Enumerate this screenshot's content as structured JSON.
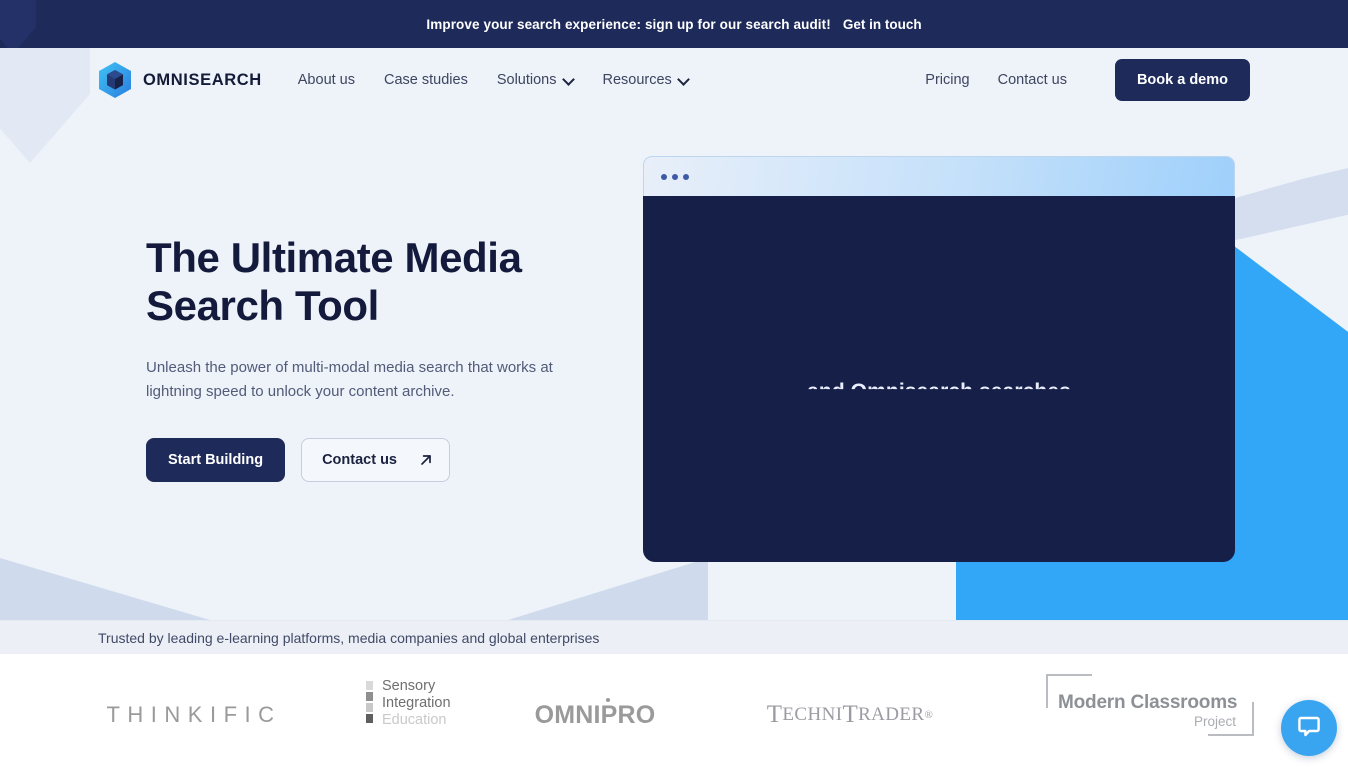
{
  "announcement": {
    "text": "Improve your search experience: sign up for our search audit!",
    "link_label": "Get in touch"
  },
  "nav": {
    "brand": "OMNISEARCH",
    "brand_icon": "hexagon-cube-logo-icon",
    "links": [
      {
        "label": "About us",
        "has_caret": false
      },
      {
        "label": "Case studies",
        "has_caret": false
      },
      {
        "label": "Solutions",
        "has_caret": true
      },
      {
        "label": "Resources",
        "has_caret": true
      }
    ],
    "right_links": [
      {
        "label": "Pricing"
      },
      {
        "label": "Contact us"
      }
    ],
    "cta_label": "Book a demo"
  },
  "hero": {
    "title_line1": "The Ultimate Media",
    "title_line2": "Search Tool",
    "subtitle": "Unleash the power of multi-modal media search that works at lightning speed to unlock your content archive.",
    "primary_cta": "Start Building",
    "secondary_cta": "Contact us",
    "secondary_cta_icon": "arrow-up-right-icon"
  },
  "mockup": {
    "window_dots": 3,
    "caption": "and Omnisearch searches"
  },
  "trusted": {
    "text": "Trusted by leading e-learning platforms, media companies and global enterprises"
  },
  "logos": [
    {
      "name": "Thinkific",
      "text": "THINKIFIC"
    },
    {
      "name": "Sensory Integration Education",
      "line1": "Sensory",
      "line2": "Integration",
      "line3": "Education"
    },
    {
      "name": "OmniPro",
      "text": "OMNIPRO"
    },
    {
      "name": "TechniTrader",
      "part1": "T",
      "part2": "ECHNI",
      "part3": "T",
      "part4": "RADER",
      "registered": "®"
    },
    {
      "name": "Modern Classrooms Project",
      "line1": "Modern Classrooms",
      "line2": "Project"
    }
  ],
  "chat": {
    "icon": "chat-bubble-icon"
  },
  "colors": {
    "announce_bg": "#1e2a5a",
    "page_bg": "#eef2f9",
    "navy": "#1e2a5a",
    "accent_blue": "#33a7f7",
    "chat_blue": "#39a5f0",
    "screen_navy": "#161f47"
  }
}
